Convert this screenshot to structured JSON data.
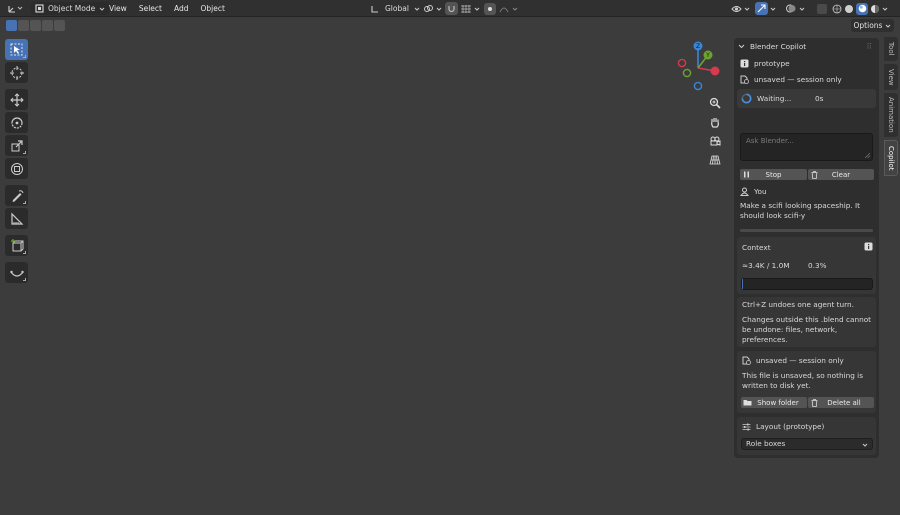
{
  "header": {
    "mode": "Object Mode",
    "menus": [
      "View",
      "Select",
      "Add",
      "Object"
    ],
    "orientation": "Global"
  },
  "subheader": {
    "options_label": "Options"
  },
  "tabs": [
    "Tool",
    "View",
    "Animation",
    "Copilot"
  ],
  "panel": {
    "title": "Blender Copilot",
    "project": "prototype",
    "session": "unsaved — session only",
    "status": "Waiting...",
    "elapsed": "0s",
    "prompt_placeholder": "Ask Blender...",
    "stop_label": "Stop",
    "clear_label": "Clear",
    "user_label": "You",
    "user_message": "Make a scifi looking spaceship. It should look scifi-y",
    "context": {
      "title": "Context",
      "tokens": "≈3.4K / 1.0M",
      "percent": "0.3%",
      "fill": 0.003
    },
    "undo_note": "Ctrl+Z undoes one agent turn.",
    "warning": "Changes outside this .blend cannot be undone: files, network, preferences.",
    "file": {
      "status": "unsaved — session only",
      "note": "This file is unsaved, so nothing is written to disk yet.",
      "show_folder": "Show folder",
      "delete_all": "Delete all"
    },
    "layout": {
      "title": "Layout (prototype)",
      "option": "Role boxes"
    }
  },
  "colors": {
    "accent": "#4772b3",
    "viewport": "#3c3c3c",
    "axis_x": "#d63a4f",
    "axis_y": "#6da232",
    "axis_z": "#3a86d6"
  }
}
